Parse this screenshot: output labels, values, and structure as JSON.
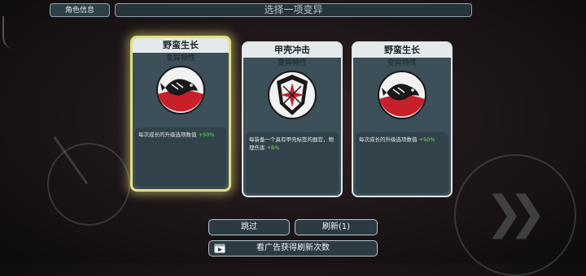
{
  "header": {
    "char_info_label": "角色信息",
    "title": "选择一项变异"
  },
  "cards": [
    {
      "title": "野蛮生长",
      "subtitle": "变异特性",
      "icon": "fish-emblem-icon",
      "desc": "每次成长的升级选项数值",
      "bonus": "+50%",
      "selected": true
    },
    {
      "title": "甲壳冲击",
      "subtitle": "变异特性",
      "icon": "shield-emblem-icon",
      "desc": "每装备一个具有甲壳标签的器官，物理伤害",
      "bonus": "+6%",
      "selected": false
    },
    {
      "title": "野蛮生长",
      "subtitle": "变异特性",
      "icon": "fish-emblem-icon",
      "desc": "每次成长的升级选项数值",
      "bonus": "+50%",
      "selected": false
    }
  ],
  "actions": {
    "skip_label": "跳过",
    "refresh_label": "刷新(1)",
    "ad_refresh_label": "看广告获得刷新次数"
  },
  "colors": {
    "selected_border": "#e3e07e",
    "bonus": "#6ee65a",
    "emblem_red": "#c8202a"
  }
}
